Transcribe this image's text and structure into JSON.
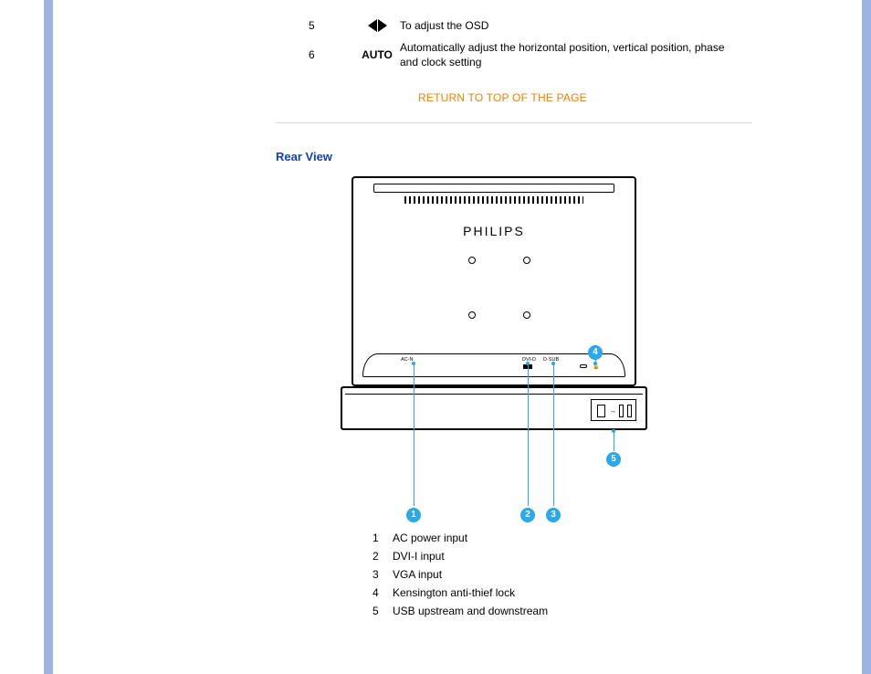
{
  "top_rows": [
    {
      "num": "5",
      "icon": "adjust-arrows-icon",
      "desc": "To adjust the OSD"
    },
    {
      "num": "6",
      "label": "AUTO",
      "desc": "Automatically adjust the horizontal position, vertical position, phase and clock setting"
    }
  ],
  "return_link": "RETURN TO TOP OF THE PAGE",
  "section_title": "Rear View",
  "brand_text": "PHILIPS",
  "port_labels": {
    "ac": "AC-N",
    "dvi": "DVI-D",
    "vga": "D·SUB"
  },
  "callouts": {
    "1": "AC power input",
    "2": "DVI-I input",
    "3": "VGA input",
    "4": "Kensington anti-thief lock",
    "5": "USB upstream and downstream"
  },
  "bubble_numbers": {
    "b1": "1",
    "b2": "2",
    "b3": "3",
    "b4": "4",
    "b5": "5"
  },
  "list_numbers": {
    "n1": "1",
    "n2": "2",
    "n3": "3",
    "n4": "4",
    "n5": "5"
  }
}
